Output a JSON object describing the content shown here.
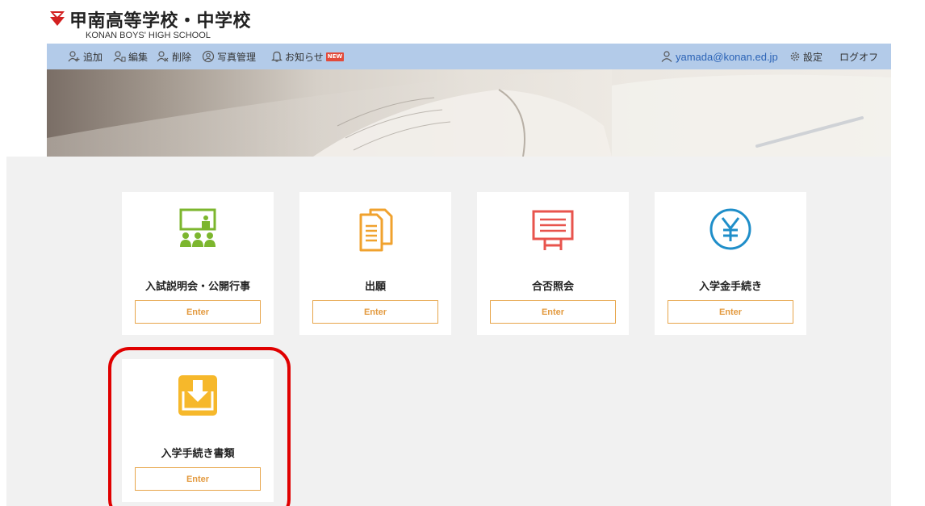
{
  "header": {
    "school_name": "甲南高等学校・中学校",
    "school_name_en": "KONAN BOYS' HIGH SCHOOL"
  },
  "toolbar": {
    "add": "追加",
    "edit": "編集",
    "delete": "削除",
    "photos": "写真管理",
    "notices": "お知らせ",
    "new_badge": "NEW",
    "user_email": "yamada@konan.ed.jp",
    "settings": "設定",
    "logout": "ログオフ"
  },
  "cards": [
    {
      "title": "入試説明会・公開行事",
      "button": "Enter",
      "icon": "seminar-icon",
      "color": "#7cb62e"
    },
    {
      "title": "出願",
      "button": "Enter",
      "icon": "documents-icon",
      "color": "#f0a22e"
    },
    {
      "title": "合否照会",
      "button": "Enter",
      "icon": "board-icon",
      "color": "#e8544d"
    },
    {
      "title": "入学金手続き",
      "button": "Enter",
      "icon": "yen-icon",
      "color": "#1f8ec9"
    },
    {
      "title": "入学手続き書類",
      "button": "Enter",
      "icon": "download-tray-icon",
      "color": "#f6b82b"
    }
  ],
  "colors": {
    "toolbar_bg": "#b3cbe9",
    "button_border": "#e7a54a",
    "highlight": "#e00000"
  }
}
